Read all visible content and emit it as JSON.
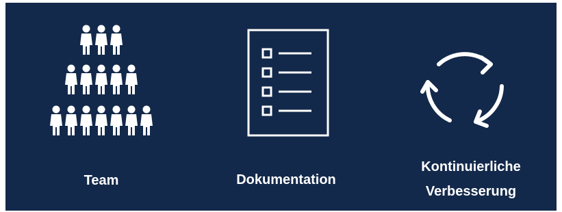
{
  "colors": {
    "background": "#13294b",
    "foreground": "#ffffff"
  },
  "features": [
    {
      "label": "Team",
      "icon": "people-pyramid-icon"
    },
    {
      "label": "Dokumentation",
      "icon": "checklist-document-icon"
    },
    {
      "label_line1": "Kontinuierliche",
      "label_line2": "Verbesserung",
      "icon": "circular-arrows-icon"
    }
  ]
}
